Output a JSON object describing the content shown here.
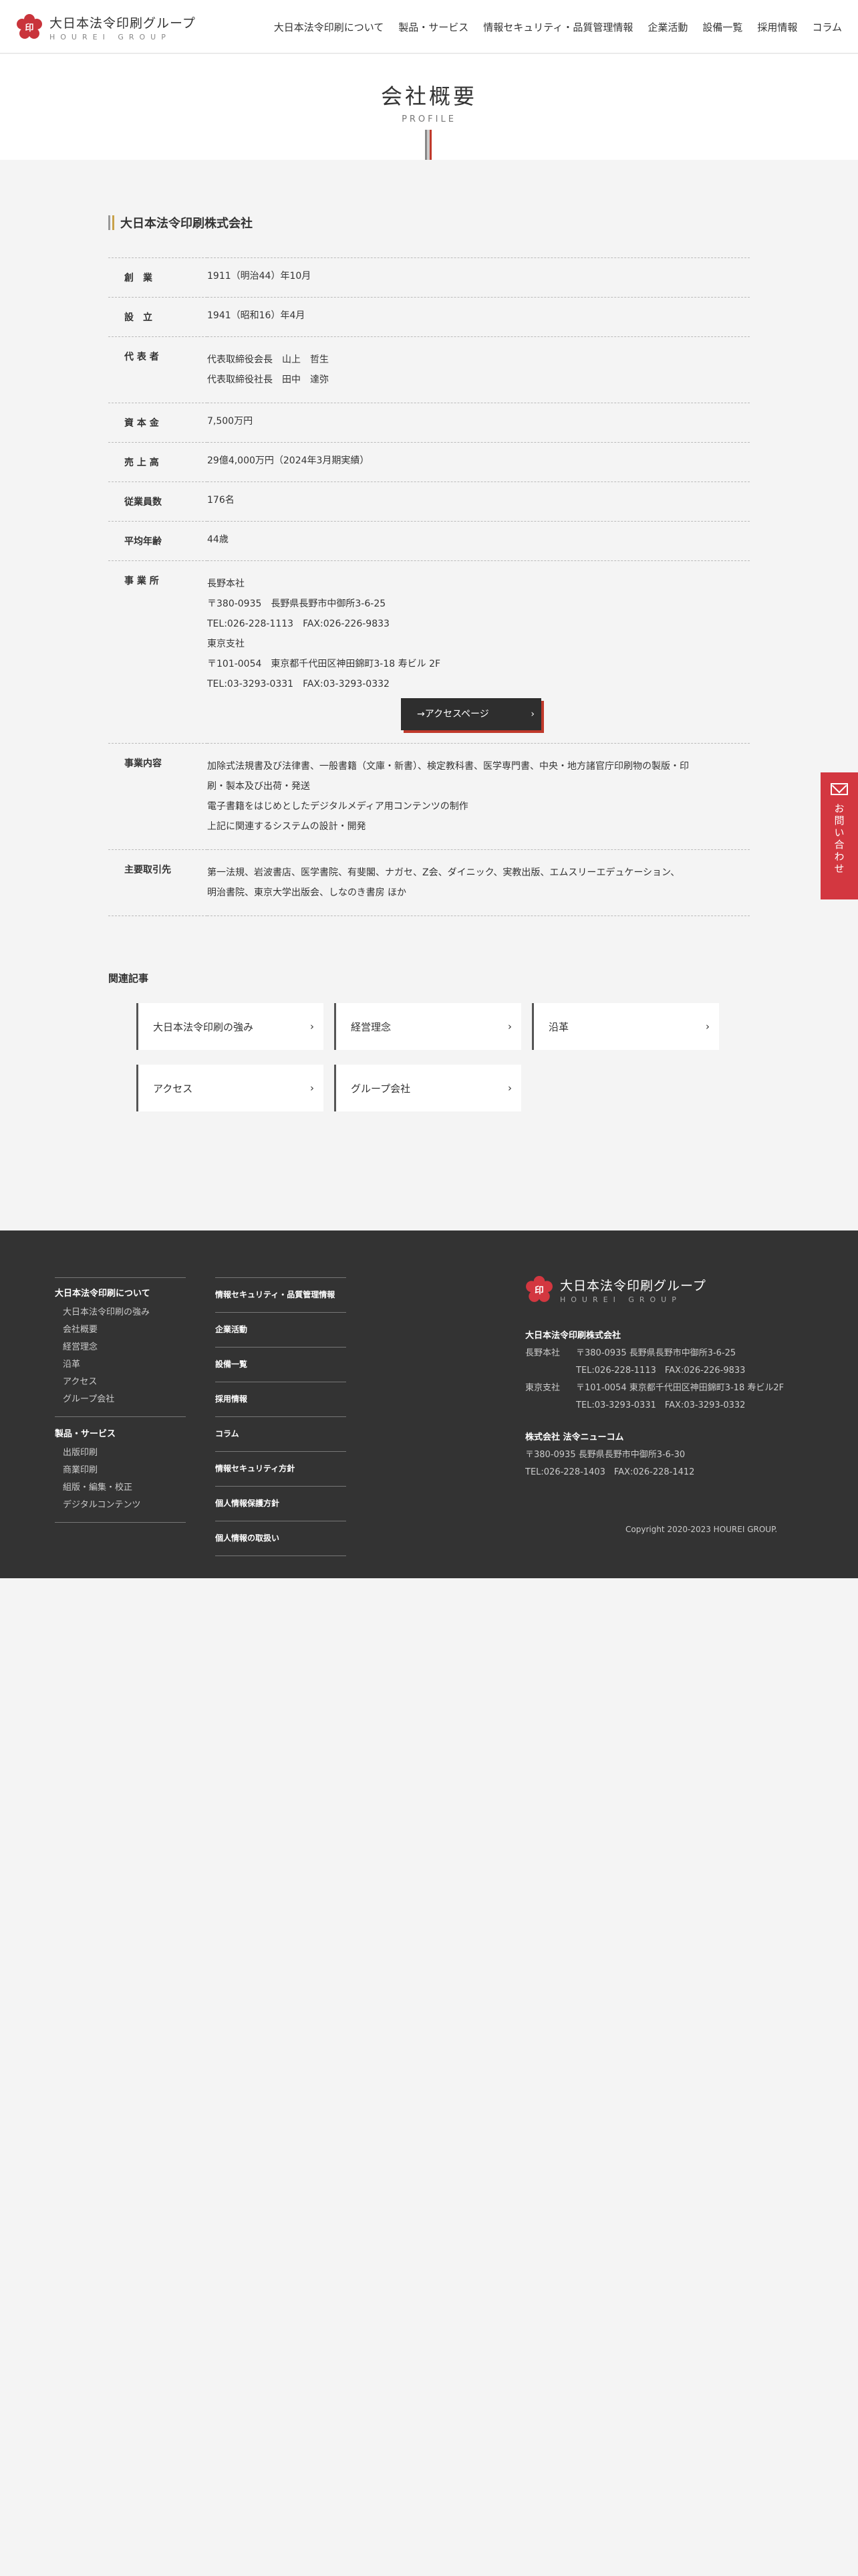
{
  "brand": {
    "name": "大日本法令印刷グループ",
    "sub": "HOUREI GROUP",
    "accent": "#c0392b"
  },
  "nav": [
    "大日本法令印刷について",
    "製品・サービス",
    "情報セキュリティ・品質管理情報",
    "企業活動",
    "設備一覧",
    "採用情報",
    "コラム"
  ],
  "page": {
    "title": "会社概要",
    "subtitle": "PROFILE"
  },
  "company": {
    "name": "大日本法令印刷株式会社",
    "rows": [
      {
        "label": "創　業",
        "lines": [
          "1911（明治44）年10月"
        ]
      },
      {
        "label": "設　立",
        "lines": [
          "1941（昭和16）年4月"
        ]
      },
      {
        "label": "代 表 者",
        "lines": [
          "代表取締役会長　山上　哲生",
          "代表取締役社長　田中　達弥"
        ]
      },
      {
        "label": "資 本 金",
        "lines": [
          "7,500万円"
        ]
      },
      {
        "label": "売 上 高",
        "lines": [
          "29億4,000万円（2024年3月期実績）"
        ]
      },
      {
        "label": "従業員数",
        "lines": [
          "176名"
        ]
      },
      {
        "label": "平均年齢",
        "lines": [
          "44歳"
        ]
      },
      {
        "label": "事 業 所",
        "lines": [
          "長野本社",
          "〒380-0935　長野県長野市中御所3-6-25",
          "TEL:026-228-1113　FAX:026-226-9833",
          "東京支社",
          "〒101-0054　東京都千代田区神田錦町3-18 寿ビル 2F",
          "TEL:03-3293-0331　FAX:03-3293-0332"
        ]
      },
      {
        "label": "事業内容",
        "lines": [
          "加除式法規書及び法律書、一般書籍（文庫・新書）、検定教科書、医学専門書、中央・地方諸官庁印刷物の製版・印",
          "刷・製本及び出荷・発送",
          "電子書籍をはじめとしたデジタルメディア用コンテンツの制作",
          "上記に関連するシステムの設計・開発"
        ]
      },
      {
        "label": "主要取引先",
        "lines": [
          "第一法規、岩波書店、医学書院、有斐閣、ナガセ、Z会、ダイニック、実教出版、エムスリーエデュケーション、",
          "明治書院、東京大学出版会、しなのき書房 ほか"
        ]
      }
    ],
    "access_button": "→アクセスページ"
  },
  "related": {
    "title": "関連記事",
    "items": [
      "大日本法令印刷の強み",
      "経営理念",
      "沿革",
      "アクセス",
      "グループ会社"
    ]
  },
  "side_contact": {
    "label": "お問い合わせ"
  },
  "footer": {
    "col1": [
      {
        "head": "大日本法令印刷について",
        "items": [
          "大日本法令印刷の強み",
          "会社概要",
          "経営理念",
          "沿革",
          "アクセス",
          "グループ会社"
        ]
      },
      {
        "head": "製品・サービス",
        "items": [
          "出版印刷",
          "商業印刷",
          "組版・編集・校正",
          "デジタルコンテンツ"
        ]
      }
    ],
    "col2": [
      "情報セキュリティ・品質管理情報",
      "企業活動",
      "設備一覧",
      "採用情報",
      "コラム",
      "情報セキュリティ方針",
      "個人情報保護方針",
      "個人情報の取扱い"
    ],
    "company1": {
      "name": "大日本法令印刷株式会社",
      "rows": [
        {
          "label": "長野本社",
          "lines": [
            "〒380-0935 長野県長野市中御所3-6-25",
            "TEL:026-228-1113　FAX:026-226-9833"
          ]
        },
        {
          "label": "東京支社",
          "lines": [
            "〒101-0054 東京都千代田区神田錦町3-18 寿ビル2F",
            "TEL:03-3293-0331　FAX:03-3293-0332"
          ]
        }
      ]
    },
    "company2": {
      "name": "株式会社 法令ニューコム",
      "lines": [
        "〒380-0935 長野県長野市中御所3-6-30",
        "TEL:026-228-1403　FAX:026-228-1412"
      ]
    },
    "copyright": "Copyright 2020-2023 HOUREI GROUP."
  }
}
